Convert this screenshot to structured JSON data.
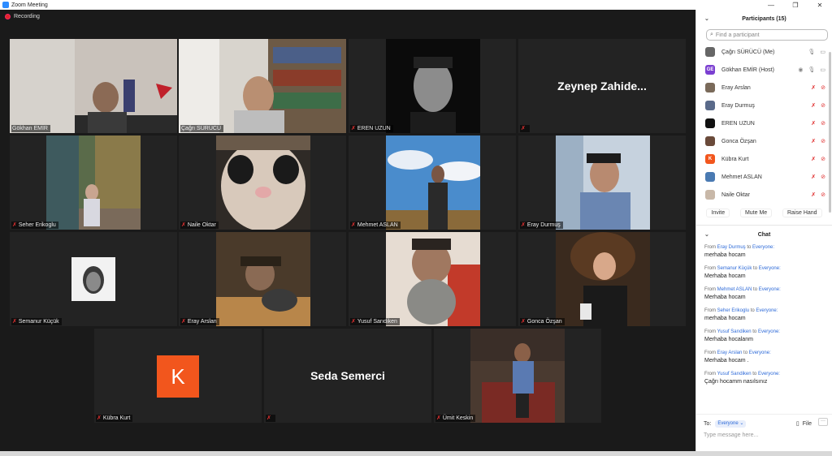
{
  "window": {
    "title": "Zoom Meeting",
    "controls": [
      "—",
      "❐",
      "✕"
    ]
  },
  "recording": {
    "label": "Recording"
  },
  "tiles": [
    {
      "name": "Gökhan EMİR",
      "muted": false
    },
    {
      "name": "Çağrı SÜRÜCÜ",
      "muted": false
    },
    {
      "name": "EREN UZUN",
      "muted": true
    },
    {
      "name": "",
      "display_name": "Zeynep  Zahide...",
      "muted": true
    },
    {
      "name": "Seher Erikoglu",
      "muted": true
    },
    {
      "name": "Naile Oktar",
      "muted": true
    },
    {
      "name": "Mehmet ASLAN",
      "muted": true
    },
    {
      "name": "Eray Durmuş",
      "muted": true
    },
    {
      "name": "Semanur Küçük",
      "muted": true
    },
    {
      "name": "Eray Arslan",
      "muted": true
    },
    {
      "name": "Yusuf Sarıdiken",
      "muted": true
    },
    {
      "name": "Gonca Özşan",
      "muted": true
    },
    {
      "name": "Kübra Kurt",
      "avatar_letter": "K",
      "muted": true
    },
    {
      "name": "",
      "display_name": "Seda Semerci",
      "muted": true
    },
    {
      "name": "Ümit Keskin",
      "muted": true
    }
  ],
  "participants": {
    "title": "Participants (15)",
    "search_placeholder": "Find a participant",
    "list": [
      {
        "name": "Çağrı SÜRÜCÜ (Me)",
        "avatar": "",
        "muted": false
      },
      {
        "name": "Gökhan EMİR (Host)",
        "avatar": "GE",
        "muted": false
      },
      {
        "name": "Eray Arslan",
        "avatar": "",
        "muted": true
      },
      {
        "name": "Eray Durmuş",
        "avatar": "",
        "muted": true
      },
      {
        "name": "EREN UZUN",
        "avatar": "",
        "muted": true
      },
      {
        "name": "Gonca Özşan",
        "avatar": "",
        "muted": true
      },
      {
        "name": "Kübra Kurt",
        "avatar": "K",
        "muted": true
      },
      {
        "name": "Mehmet ASLAN",
        "avatar": "",
        "muted": true
      },
      {
        "name": "Naile Oktar",
        "avatar": "",
        "muted": true
      }
    ],
    "actions": {
      "invite": "Invite",
      "mute_me": "Mute Me",
      "raise_hand": "Raise Hand"
    }
  },
  "chat": {
    "title": "Chat",
    "from_word": "From",
    "to_word": "to",
    "messages": [
      {
        "from": "Eray Durmuş",
        "to": "Everyone:",
        "text": "merhaba hocam"
      },
      {
        "from": "Semanur Küçük",
        "to": "Everyone:",
        "text": "Merhaba hocam"
      },
      {
        "from": "Mehmet ASLAN",
        "to": "Everyone:",
        "text": "Merhaba hocam"
      },
      {
        "from": "Seher Erikoglu",
        "to": "Everyone:",
        "text": "merhaba hocam"
      },
      {
        "from": "Yusuf Sarıdiken",
        "to": "Everyone:",
        "text": "Merhaba hocalanm"
      },
      {
        "from": "Eray Arslan",
        "to": "Everyone:",
        "text": "Merhaba hocam ."
      },
      {
        "from": "Yusuf Sarıdiken",
        "to": "Everyone:",
        "text": "Çağrı hocamm nasılsınız"
      }
    ],
    "to_label": "To:",
    "to_value": "Everyone",
    "file_label": "File",
    "more_label": "···",
    "input_placeholder": "Type message here..."
  },
  "colors": {
    "accent": "#2d8cff",
    "active_speaker": "#9ad21d",
    "muted": "#e03030",
    "host_avatar": "#7b3fd1",
    "kubra_avatar": "#f2561d",
    "link_blue": "#2d6ad8"
  }
}
